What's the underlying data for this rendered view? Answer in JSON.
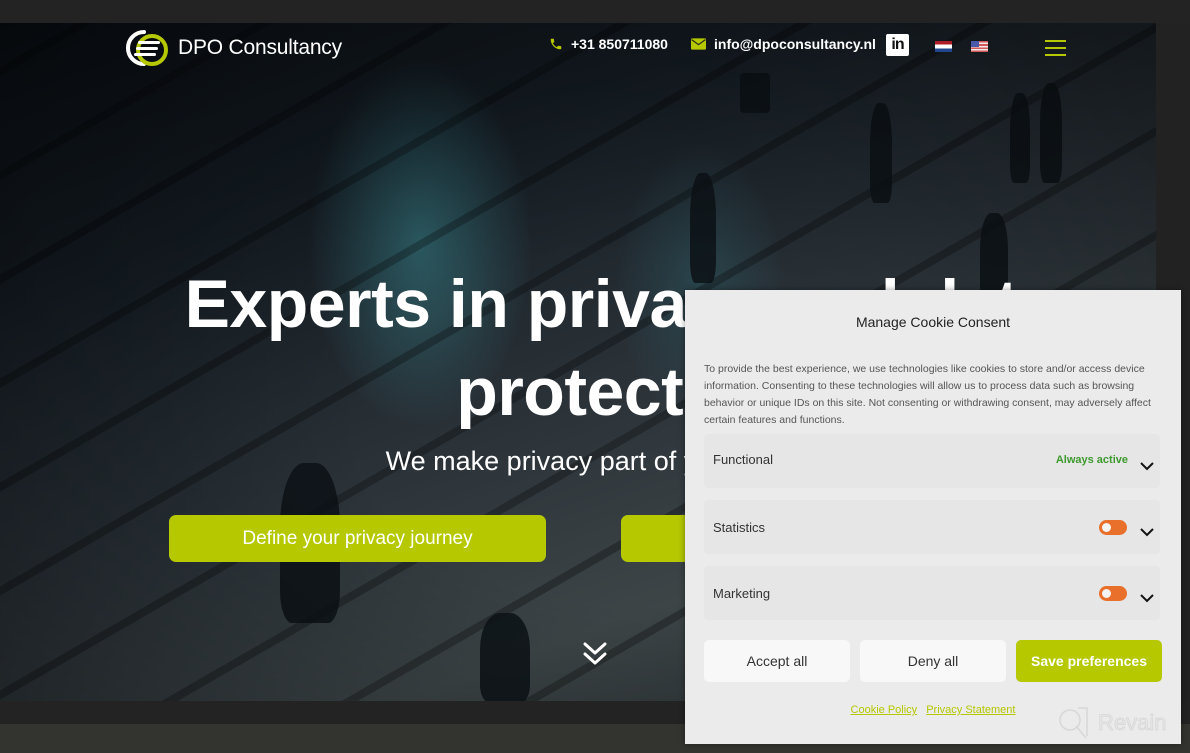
{
  "header": {
    "logo_text": "DPO Consultancy",
    "phone": "+31 850711080",
    "email": "info@dpoconsultancy.nl",
    "icons": {
      "phone": "phone-icon",
      "email": "envelope-icon",
      "linkedin": "linkedin-icon",
      "linkedin_text": "in",
      "flag_nl": "dutch-flag-icon",
      "flag_us": "us-flag-icon",
      "menu": "hamburger-menu-icon"
    }
  },
  "hero": {
    "headline_line1": "Experts in privacy and data",
    "headline_line2": "protection",
    "subline": "We make privacy part of your business",
    "cta_primary": "Define your privacy journey",
    "cta_secondary": "",
    "scroll_icon": "double-chevron-down-icon"
  },
  "colors": {
    "brand_green": "#b5c800",
    "toggle_orange": "#e8702a",
    "always_active_green": "#3d9a2d"
  },
  "cookie_modal": {
    "title": "Manage Cookie Consent",
    "description": "To provide the best experience, we use technologies like cookies to store and/or access device information. Consenting to these technologies will allow us to process data such as browsing behavior or unique IDs on this site. Not consenting or withdrawing consent, may adversely affect certain features and functions.",
    "categories": [
      {
        "label": "Functional",
        "status": "Always active"
      },
      {
        "label": "Statistics",
        "enabled": false
      },
      {
        "label": "Marketing",
        "enabled": false
      }
    ],
    "buttons": {
      "accept": "Accept all",
      "deny": "Deny all",
      "save": "Save preferences"
    },
    "links": {
      "cookie_policy": "Cookie Policy",
      "privacy_statement": "Privacy Statement"
    }
  },
  "watermark": {
    "text": "Revain"
  }
}
